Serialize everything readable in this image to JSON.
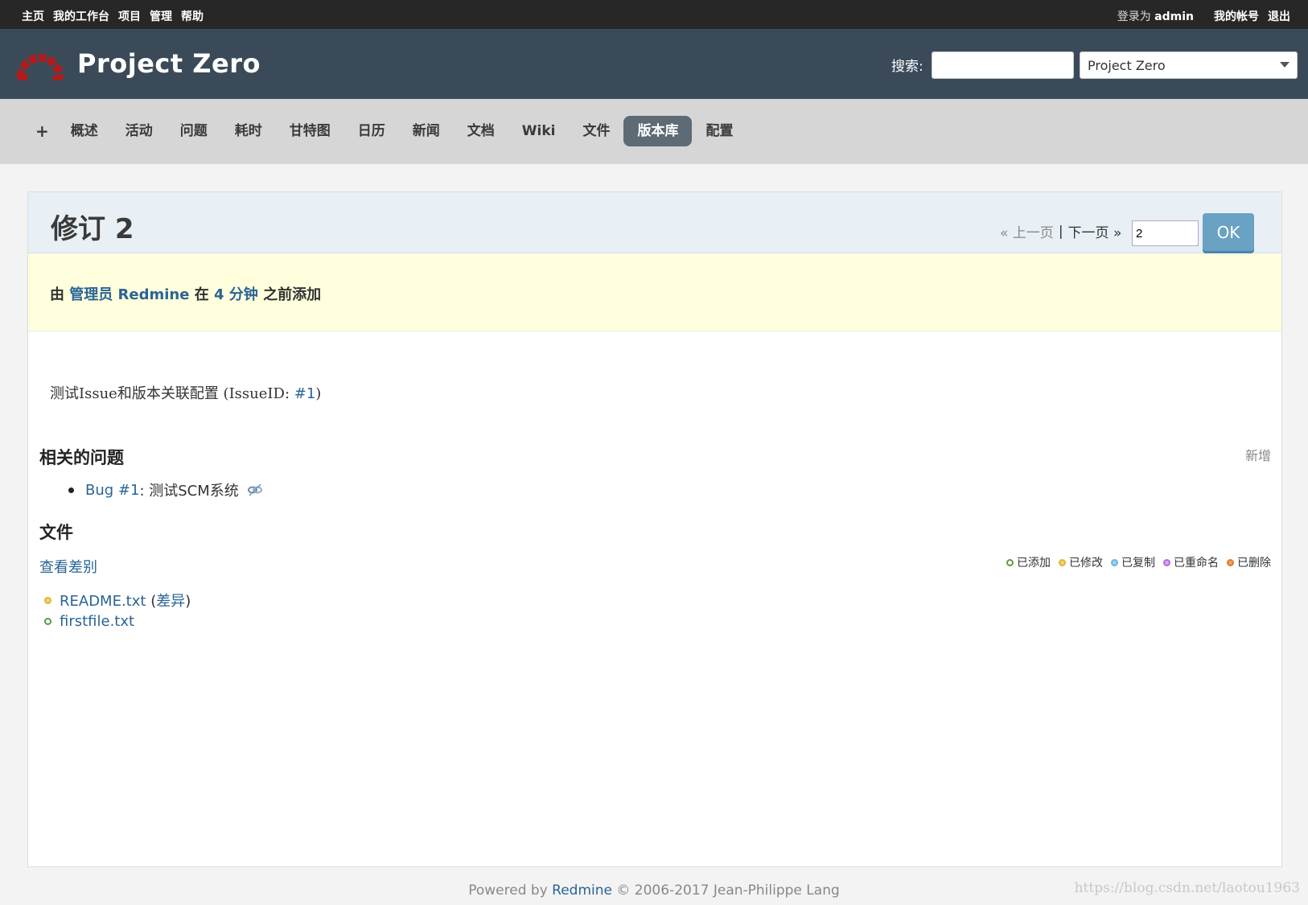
{
  "top_menu": {
    "left": [
      "主页",
      "我的工作台",
      "项目",
      "管理",
      "帮助"
    ],
    "logged_as_prefix": "登录为",
    "user": "admin",
    "my_account": "我的帐号",
    "logout": "退出"
  },
  "header": {
    "project_title": "Project Zero",
    "search_label": "搜索:",
    "search_value": "",
    "project_jump_value": "Project Zero"
  },
  "main_menu": {
    "items": [
      "+",
      "概述",
      "活动",
      "问题",
      "耗时",
      "甘特图",
      "日历",
      "新闻",
      "文档",
      "Wiki",
      "文件",
      "版本库",
      "配置"
    ],
    "selected": "版本库"
  },
  "revision": {
    "title": "修订 2",
    "prev": "« 上一页",
    "separator": "|",
    "next": "下一页 »",
    "rev_input_value": "2",
    "ok_label": "OK"
  },
  "author": {
    "by": "由",
    "user": "管理员 Redmine",
    "at": "在",
    "time": "4 分钟",
    "suffix": "之前添加"
  },
  "comment": {
    "text": "测试Issue和版本关联配置 (IssueID: ",
    "issue_link": "#1",
    "close": ")"
  },
  "related": {
    "heading": "相关的问题",
    "add_label": "新增",
    "items": [
      {
        "tracker": "Bug",
        "id": "#1",
        "subject": ": 测试SCM系统"
      }
    ]
  },
  "files": {
    "heading": "文件",
    "view_diff": "查看差别",
    "legend": [
      {
        "label": "已添加",
        "kind": "added"
      },
      {
        "label": "已修改",
        "kind": "modified"
      },
      {
        "label": "已复制",
        "kind": "copied"
      },
      {
        "label": "已重命名",
        "kind": "renamed"
      },
      {
        "label": "已删除",
        "kind": "deleted"
      }
    ],
    "list": [
      {
        "name": "README.txt",
        "status": "modified",
        "diff_open": "(",
        "diff_label": "差异",
        "diff_close": ")"
      },
      {
        "name": "firstfile.txt",
        "status": "added"
      }
    ]
  },
  "footer": {
    "prefix": "Powered by",
    "link": "Redmine",
    "suffix": "© 2006-2017 Jean-Philippe Lang"
  },
  "watermark": "https://blog.csdn.net/laotou1963"
}
